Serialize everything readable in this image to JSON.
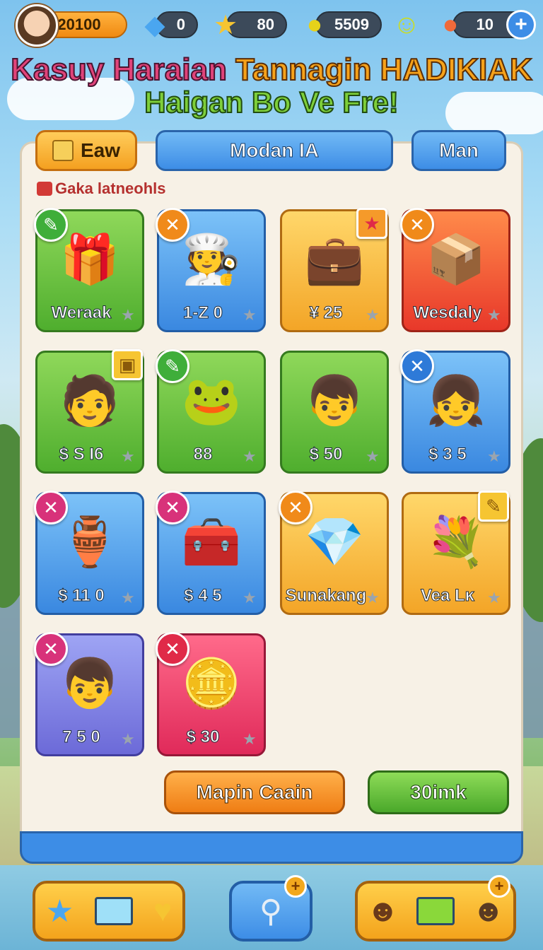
{
  "hud": {
    "coins": "20100",
    "gems": "0",
    "stars": "80",
    "fruit": "5509",
    "smiles": "",
    "fish": "10",
    "plus_symbol": "+"
  },
  "title": {
    "line1_part1": "Kasuy Haraian ",
    "line1_part2": "Tannagin HADIKIAK",
    "line2": "Haigan Bo Ve Fre!"
  },
  "tabs": [
    {
      "label": "Eaw"
    },
    {
      "label": "Modan IA"
    },
    {
      "label": "Man"
    }
  ],
  "section_label": "Gaka latneohls",
  "cards": [
    {
      "label": "Weraak",
      "color": "green",
      "badge": "✎",
      "badge_type": "green",
      "art": "🎁"
    },
    {
      "label": "1-Z 0",
      "color": "blue",
      "badge": "✕",
      "badge_type": "orange",
      "art": "🧑‍🍳"
    },
    {
      "label": "¥ 25",
      "color": "yellow",
      "badge": "★",
      "badge_type": "sq red",
      "art": "💼"
    },
    {
      "label": "Wesdaly",
      "color": "red",
      "badge": "✕",
      "badge_type": "orange",
      "art": "📦"
    },
    {
      "label": "$ S I6",
      "color": "green",
      "badge": "▣",
      "badge_type": "sq yellow",
      "art": "🧑"
    },
    {
      "label": "88",
      "color": "green",
      "badge": "✎",
      "badge_type": "green",
      "art": "🐸"
    },
    {
      "label": "$ 50",
      "color": "green",
      "badge": "",
      "badge_type": "",
      "art": "👦"
    },
    {
      "label": "$ 3 5",
      "color": "blue",
      "badge": "✕",
      "badge_type": "blue",
      "art": "👧"
    },
    {
      "label": "$ 11 0",
      "color": "blue",
      "badge": "✕",
      "badge_type": "pink",
      "art": "🏺"
    },
    {
      "label": "$ 4 5",
      "color": "blue",
      "badge": "✕",
      "badge_type": "pink",
      "art": "🧰"
    },
    {
      "label": "Sunakang",
      "color": "yellow",
      "badge": "✕",
      "badge_type": "orange",
      "art": "💎"
    },
    {
      "label": "Vea Lĸ",
      "color": "yellow",
      "badge": "✎",
      "badge_type": "sq yellow",
      "art": "💐"
    },
    {
      "label": "7 5 0",
      "color": "purple",
      "badge": "✕",
      "badge_type": "pink",
      "art": "👦"
    },
    {
      "label": "$ 30",
      "color": "pink",
      "badge": "✕",
      "badge_type": "red",
      "art": "🪙"
    }
  ],
  "buttons": {
    "primary": "Mapin Caain",
    "secondary": "30imk"
  },
  "icons": {
    "coin": "avatar-icon",
    "gem": "gem-icon",
    "star": "star-icon",
    "fruit": "fruit-icon",
    "smile": "smile-icon",
    "fish": "fish-icon"
  },
  "colors": {
    "accent_blue": "#3d8de6",
    "accent_orange": "#f08a12",
    "accent_green": "#4aa82a"
  }
}
